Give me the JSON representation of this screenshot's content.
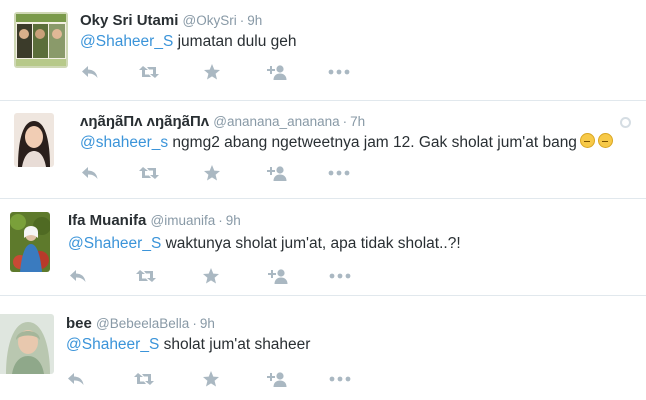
{
  "tweets": [
    {
      "name": "Oky Sri Utami",
      "handle": "@OkySri",
      "separator": "·",
      "time": "9h",
      "mention": "@Shaheer_S",
      "body": " jumatan dulu geh"
    },
    {
      "name": "ʌŋãŋãПʌ ʌŋãŋãПʌ",
      "handle": "@ananana_ananana",
      "separator": "·",
      "time": "7h",
      "mention": "@shaheer_s",
      "body": " ngmg2 abang ngetweetnya jam 12. Gak sholat jum'at bang"
    },
    {
      "name": "Ifa Muanifa",
      "handle": "@imuanifa",
      "separator": "·",
      "time": "9h",
      "mention": "@Shaheer_S",
      "body": " waktunya sholat jum'at, apa tidak sholat..?!"
    },
    {
      "name": "bee",
      "handle": "@BebeelaBella",
      "separator": "·",
      "time": "9h",
      "mention": "@Shaheer_S",
      "body": " sholat jum'at shaheer"
    }
  ],
  "icons": {
    "reply": "reply-icon",
    "retweet": "retweet-icon",
    "favorite": "star-icon",
    "follow": "add-user-icon",
    "more": "more-dots-icon"
  },
  "colors": {
    "mention": "#3b94d9",
    "meta": "#8899a6",
    "icon": "#aab8c2",
    "divider": "#e1e8ed"
  }
}
